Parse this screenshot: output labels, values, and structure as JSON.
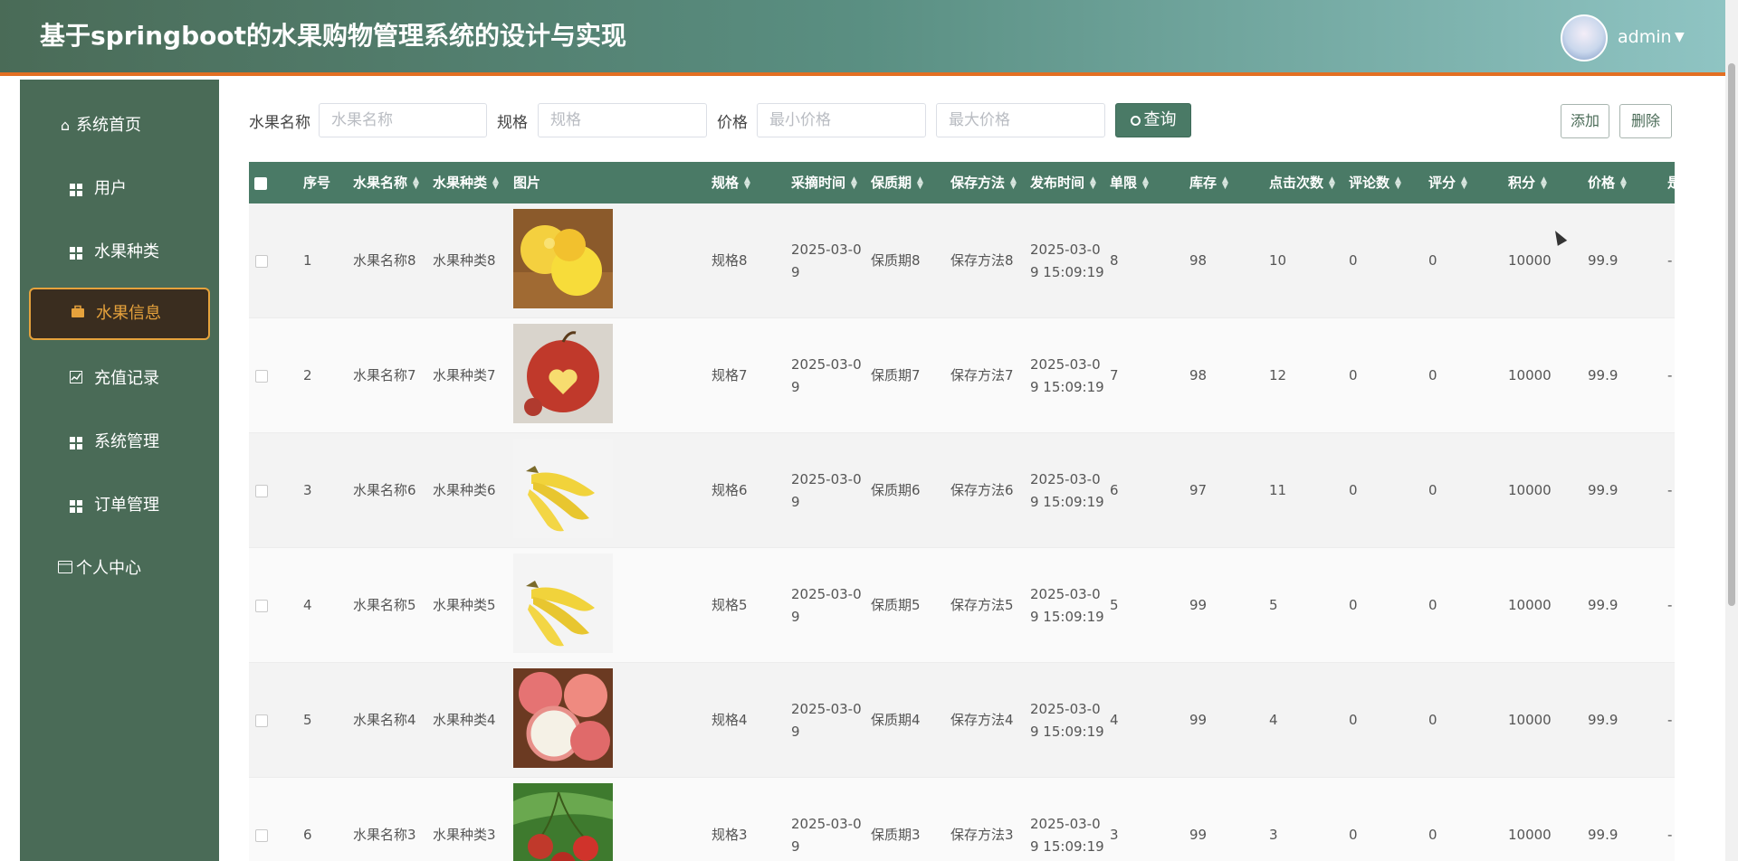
{
  "app": {
    "title": "基于springboot的水果购物管理系统的设计与实现",
    "user": "admin"
  },
  "sidebar": {
    "items": [
      {
        "label": "系统首页",
        "icon": "home-icon"
      },
      {
        "label": "用户",
        "icon": "grid-icon"
      },
      {
        "label": "水果种类",
        "icon": "grid-icon"
      },
      {
        "label": "水果信息",
        "icon": "briefcase-icon",
        "active": true
      },
      {
        "label": "充值记录",
        "icon": "chart-icon"
      },
      {
        "label": "系统管理",
        "icon": "grid-icon"
      },
      {
        "label": "订单管理",
        "icon": "grid-icon"
      },
      {
        "label": "个人中心",
        "icon": "card-icon"
      }
    ]
  },
  "search": {
    "name_label": "水果名称",
    "name_placeholder": "水果名称",
    "spec_label": "规格",
    "spec_placeholder": "规格",
    "price_label": "价格",
    "min_price_placeholder": "最小价格",
    "max_price_placeholder": "最大价格",
    "query_label": "查询",
    "add_label": "添加",
    "delete_label": "删除"
  },
  "table": {
    "headers": {
      "index": "序号",
      "name": "水果名称",
      "category": "水果种类",
      "image": "图片",
      "spec": "规格",
      "pick_time": "采摘时间",
      "shelf_life": "保质期",
      "storage": "保存方法",
      "publish_time": "发布时间",
      "limit": "单限",
      "stock": "库存",
      "clicks": "点击次数",
      "comments": "评论数",
      "rating": "评分",
      "points": "积分",
      "price": "价格",
      "more": "是"
    },
    "rows": [
      {
        "index": "1",
        "name": "水果名称8",
        "category": "水果种类8",
        "fruit": "yellow-apple",
        "spec": "规格8",
        "pick1": "2025-03-0",
        "pick2": "9",
        "shelf": "保质期8",
        "storage": "保存方法8",
        "pub1": "2025-03-0",
        "pub2": "9 15:09:19",
        "limit": "8",
        "stock": "98",
        "clicks": "10",
        "comments": "0",
        "rating": "0",
        "points": "10000",
        "price": "99.9"
      },
      {
        "index": "2",
        "name": "水果名称7",
        "category": "水果种类7",
        "fruit": "red-apple",
        "spec": "规格7",
        "pick1": "2025-03-0",
        "pick2": "9",
        "shelf": "保质期7",
        "storage": "保存方法7",
        "pub1": "2025-03-0",
        "pub2": "9 15:09:19",
        "limit": "7",
        "stock": "98",
        "clicks": "12",
        "comments": "0",
        "rating": "0",
        "points": "10000",
        "price": "99.9"
      },
      {
        "index": "3",
        "name": "水果名称6",
        "category": "水果种类6",
        "fruit": "banana",
        "spec": "规格6",
        "pick1": "2025-03-0",
        "pick2": "9",
        "shelf": "保质期6",
        "storage": "保存方法6",
        "pub1": "2025-03-0",
        "pub2": "9 15:09:19",
        "limit": "6",
        "stock": "97",
        "clicks": "11",
        "comments": "0",
        "rating": "0",
        "points": "10000",
        "price": "99.9"
      },
      {
        "index": "4",
        "name": "水果名称5",
        "category": "水果种类5",
        "fruit": "banana",
        "spec": "规格5",
        "pick1": "2025-03-0",
        "pick2": "9",
        "shelf": "保质期5",
        "storage": "保存方法5",
        "pub1": "2025-03-0",
        "pub2": "9 15:09:19",
        "limit": "5",
        "stock": "99",
        "clicks": "5",
        "comments": "0",
        "rating": "0",
        "points": "10000",
        "price": "99.9"
      },
      {
        "index": "5",
        "name": "水果名称4",
        "category": "水果种类4",
        "fruit": "peach",
        "spec": "规格4",
        "pick1": "2025-03-0",
        "pick2": "9",
        "shelf": "保质期4",
        "storage": "保存方法4",
        "pub1": "2025-03-0",
        "pub2": "9 15:09:19",
        "limit": "4",
        "stock": "99",
        "clicks": "4",
        "comments": "0",
        "rating": "0",
        "points": "10000",
        "price": "99.9"
      },
      {
        "index": "6",
        "name": "水果名称3",
        "category": "水果种类3",
        "fruit": "cherry",
        "spec": "规格3",
        "pick1": "2025-03-0",
        "pick2": "9",
        "shelf": "保质期3",
        "storage": "保存方法3",
        "pub1": "2025-03-0",
        "pub2": "9 15:09:19",
        "limit": "3",
        "stock": "99",
        "clicks": "3",
        "comments": "0",
        "rating": "0",
        "points": "10000",
        "price": "99.9"
      }
    ]
  }
}
